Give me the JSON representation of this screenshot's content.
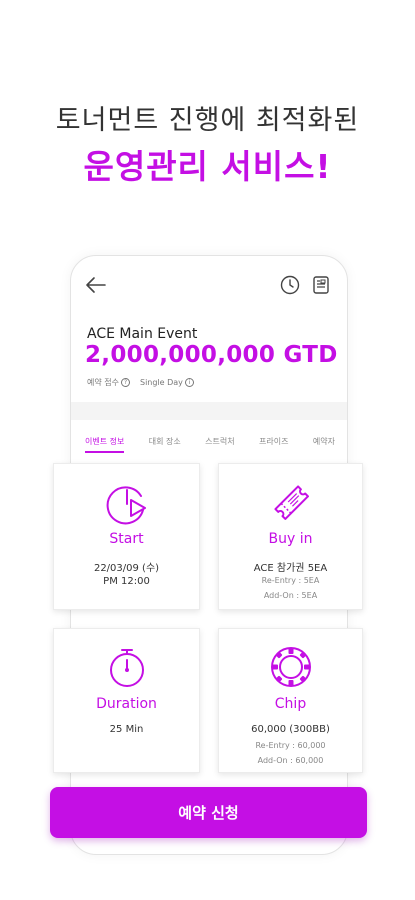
{
  "headline": {
    "line1": "토너먼트 진행에 최적화된",
    "line2": "운영관리 서비스!"
  },
  "event": {
    "name": "ACE Main Event",
    "prize": "2,000,000,000 GTD",
    "meta": [
      "예약 접수",
      "Single Day"
    ]
  },
  "tabs": [
    {
      "label": "이벤트 정보",
      "active": true
    },
    {
      "label": "대회 장소",
      "active": false
    },
    {
      "label": "스트럭처",
      "active": false
    },
    {
      "label": "프라이즈",
      "active": false
    },
    {
      "label": "예약자",
      "active": false
    }
  ],
  "cards": {
    "start": {
      "title": "Start",
      "line1": "22/03/09 (수)",
      "line2": "PM 12:00",
      "icon": "play-clock-icon"
    },
    "buyin": {
      "title": "Buy in",
      "line1": "ACE 참가권 5EA",
      "sub1": "Re-Entry : 5EA",
      "sub2": "Add-On : 5EA",
      "icon": "ticket-icon"
    },
    "duration": {
      "title": "Duration",
      "line1": "25 Min",
      "icon": "stopwatch-icon"
    },
    "chip": {
      "title": "Chip",
      "line1": "60,000 (300BB)",
      "sub1": "Re-Entry : 60,000",
      "sub2": "Add-On : 60,000",
      "icon": "poker-chip-icon"
    }
  },
  "cta": {
    "label": "예약 신청"
  },
  "colors": {
    "accent": "#c40fe4"
  }
}
